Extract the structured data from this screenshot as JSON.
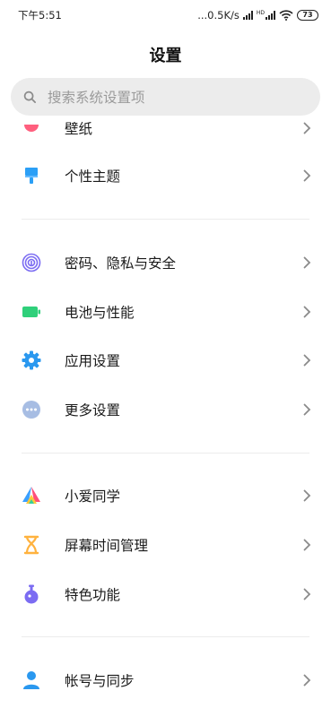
{
  "status_bar": {
    "time": "下午5:51",
    "net_speed": "...0.5K/s",
    "hd_label": "HD",
    "battery": "73"
  },
  "header": {
    "title": "设置"
  },
  "search": {
    "placeholder": "搜索系统设置项"
  },
  "groups": [
    {
      "items": [
        {
          "label": "壁纸",
          "icon": "wallpaper-icon",
          "color": "#ff5f7e"
        },
        {
          "label": "个性主题",
          "icon": "theme-brush-icon",
          "color": "#2b9ff6"
        }
      ]
    },
    {
      "items": [
        {
          "label": "密码、隐私与安全",
          "icon": "fingerprint-icon",
          "color": "#7b6cf2"
        },
        {
          "label": "电池与性能",
          "icon": "battery-icon",
          "color": "#2fd07a"
        },
        {
          "label": "应用设置",
          "icon": "gear-icon",
          "color": "#2a98ef"
        },
        {
          "label": "更多设置",
          "icon": "more-dots-icon",
          "color": "#8fa9d6"
        }
      ]
    },
    {
      "items": [
        {
          "label": "小爱同学",
          "icon": "xiaoai-icon",
          "color": "#ff4f7a"
        },
        {
          "label": "屏幕时间管理",
          "icon": "hourglass-icon",
          "color": "#ffb23e"
        },
        {
          "label": "特色功能",
          "icon": "flask-icon",
          "color": "#7b6cf2"
        }
      ]
    },
    {
      "items": [
        {
          "label": "帐号与同步",
          "icon": "account-icon",
          "color": "#2a98ef"
        }
      ]
    }
  ]
}
